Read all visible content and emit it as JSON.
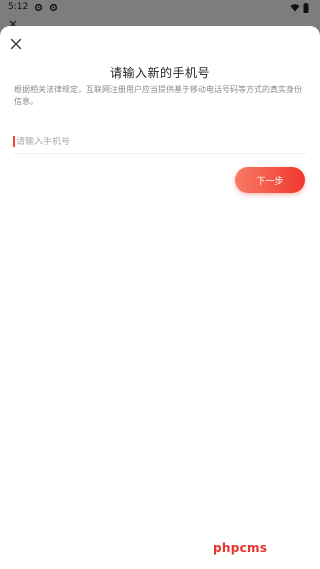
{
  "status_bar": {
    "time": "5:12",
    "left_icons": [
      "settings-icon",
      "settings-icon"
    ],
    "right_icons": [
      "wifi-icon",
      "battery-icon"
    ]
  },
  "underlying_page": {
    "title": "",
    "back_icon": "back-icon"
  },
  "dialog": {
    "close_icon": "close-icon",
    "title": "请输入新的手机号",
    "description": "根据相关法律规定，互联网注册用户应当提供基于移动电话号码等方式的真实身份信息。",
    "phone_input": {
      "value": "",
      "placeholder": "请输入手机号"
    },
    "next_button_label": "下一步"
  },
  "watermark": "phpcms",
  "colors": {
    "accent": "#f0382f",
    "accent_light": "#f97a64",
    "overlay": "#7d7d7d",
    "sheet": "#ffffff",
    "description_text": "#8a8a8a"
  }
}
